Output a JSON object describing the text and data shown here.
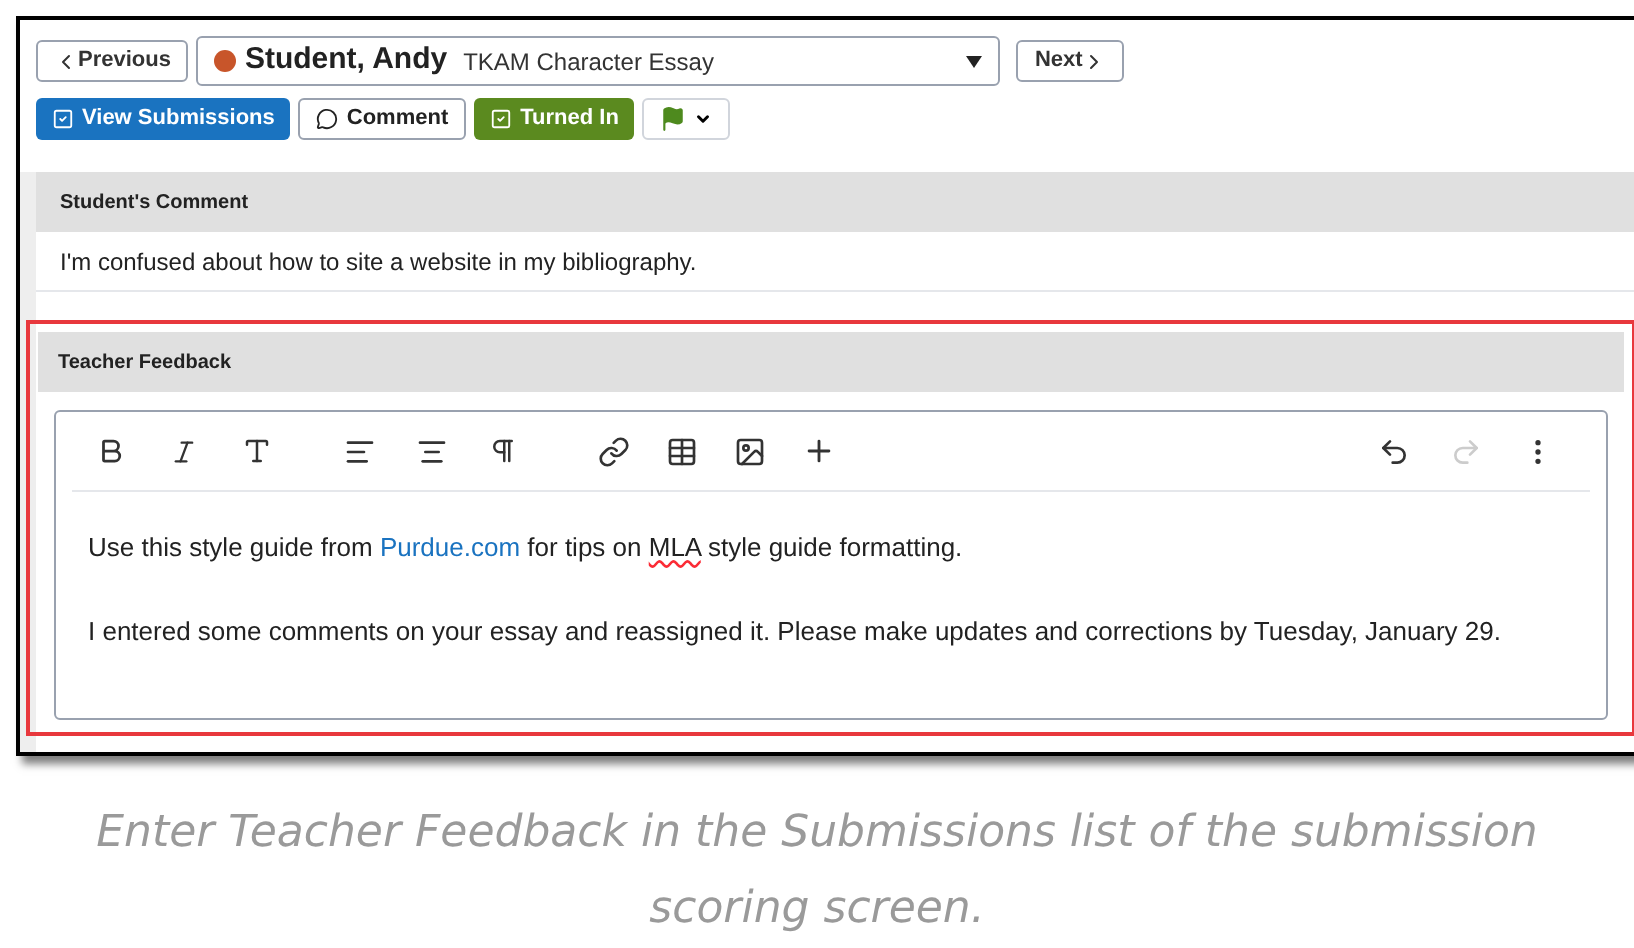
{
  "nav": {
    "previous": "Previous",
    "next": "Next",
    "student": "Student, Andy",
    "assignment": "TKAM Character Essay"
  },
  "actions": [
    {
      "kind": "view",
      "label": "View Submissions"
    },
    {
      "kind": "comment",
      "label": "Comment"
    },
    {
      "kind": "turned",
      "label": "Turned In"
    },
    {
      "kind": "flag"
    }
  ],
  "student_comment": {
    "title": "Student's Comment",
    "text": "I'm confused about how to site a website in my bibliography."
  },
  "teacher_feedback": {
    "title": "Teacher Feedback",
    "highlighted": true,
    "redo_disabled": true,
    "paragraphs": [
      [
        {
          "kind": "text",
          "text": "Use this style guide from "
        },
        {
          "kind": "link",
          "text": "Purdue.com"
        },
        {
          "kind": "text",
          "text": " for tips on "
        },
        {
          "kind": "misspelled",
          "text": "MLA"
        },
        {
          "kind": "text",
          "text": " style guide formatting."
        }
      ],
      [
        {
          "kind": "text",
          "text": "I entered some comments on your essay and reassigned it. Please make updates and corrections by Tuesday, January 29."
        }
      ]
    ]
  },
  "caption": "Enter Teacher Feedback in the Submissions list of the submission scoring screen."
}
